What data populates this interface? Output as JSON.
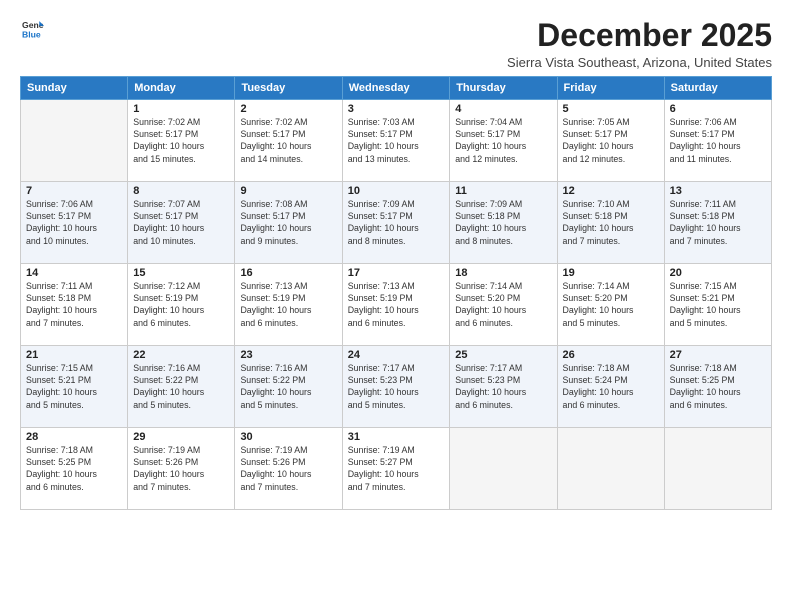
{
  "logo": {
    "line1": "General",
    "line2": "Blue"
  },
  "title": "December 2025",
  "location": "Sierra Vista Southeast, Arizona, United States",
  "headers": [
    "Sunday",
    "Monday",
    "Tuesday",
    "Wednesday",
    "Thursday",
    "Friday",
    "Saturday"
  ],
  "weeks": [
    [
      {
        "day": "",
        "info": ""
      },
      {
        "day": "1",
        "info": "Sunrise: 7:02 AM\nSunset: 5:17 PM\nDaylight: 10 hours\nand 15 minutes."
      },
      {
        "day": "2",
        "info": "Sunrise: 7:02 AM\nSunset: 5:17 PM\nDaylight: 10 hours\nand 14 minutes."
      },
      {
        "day": "3",
        "info": "Sunrise: 7:03 AM\nSunset: 5:17 PM\nDaylight: 10 hours\nand 13 minutes."
      },
      {
        "day": "4",
        "info": "Sunrise: 7:04 AM\nSunset: 5:17 PM\nDaylight: 10 hours\nand 12 minutes."
      },
      {
        "day": "5",
        "info": "Sunrise: 7:05 AM\nSunset: 5:17 PM\nDaylight: 10 hours\nand 12 minutes."
      },
      {
        "day": "6",
        "info": "Sunrise: 7:06 AM\nSunset: 5:17 PM\nDaylight: 10 hours\nand 11 minutes."
      }
    ],
    [
      {
        "day": "7",
        "info": "Sunrise: 7:06 AM\nSunset: 5:17 PM\nDaylight: 10 hours\nand 10 minutes."
      },
      {
        "day": "8",
        "info": "Sunrise: 7:07 AM\nSunset: 5:17 PM\nDaylight: 10 hours\nand 10 minutes."
      },
      {
        "day": "9",
        "info": "Sunrise: 7:08 AM\nSunset: 5:17 PM\nDaylight: 10 hours\nand 9 minutes."
      },
      {
        "day": "10",
        "info": "Sunrise: 7:09 AM\nSunset: 5:17 PM\nDaylight: 10 hours\nand 8 minutes."
      },
      {
        "day": "11",
        "info": "Sunrise: 7:09 AM\nSunset: 5:18 PM\nDaylight: 10 hours\nand 8 minutes."
      },
      {
        "day": "12",
        "info": "Sunrise: 7:10 AM\nSunset: 5:18 PM\nDaylight: 10 hours\nand 7 minutes."
      },
      {
        "day": "13",
        "info": "Sunrise: 7:11 AM\nSunset: 5:18 PM\nDaylight: 10 hours\nand 7 minutes."
      }
    ],
    [
      {
        "day": "14",
        "info": "Sunrise: 7:11 AM\nSunset: 5:18 PM\nDaylight: 10 hours\nand 7 minutes."
      },
      {
        "day": "15",
        "info": "Sunrise: 7:12 AM\nSunset: 5:19 PM\nDaylight: 10 hours\nand 6 minutes."
      },
      {
        "day": "16",
        "info": "Sunrise: 7:13 AM\nSunset: 5:19 PM\nDaylight: 10 hours\nand 6 minutes."
      },
      {
        "day": "17",
        "info": "Sunrise: 7:13 AM\nSunset: 5:19 PM\nDaylight: 10 hours\nand 6 minutes."
      },
      {
        "day": "18",
        "info": "Sunrise: 7:14 AM\nSunset: 5:20 PM\nDaylight: 10 hours\nand 6 minutes."
      },
      {
        "day": "19",
        "info": "Sunrise: 7:14 AM\nSunset: 5:20 PM\nDaylight: 10 hours\nand 5 minutes."
      },
      {
        "day": "20",
        "info": "Sunrise: 7:15 AM\nSunset: 5:21 PM\nDaylight: 10 hours\nand 5 minutes."
      }
    ],
    [
      {
        "day": "21",
        "info": "Sunrise: 7:15 AM\nSunset: 5:21 PM\nDaylight: 10 hours\nand 5 minutes."
      },
      {
        "day": "22",
        "info": "Sunrise: 7:16 AM\nSunset: 5:22 PM\nDaylight: 10 hours\nand 5 minutes."
      },
      {
        "day": "23",
        "info": "Sunrise: 7:16 AM\nSunset: 5:22 PM\nDaylight: 10 hours\nand 5 minutes."
      },
      {
        "day": "24",
        "info": "Sunrise: 7:17 AM\nSunset: 5:23 PM\nDaylight: 10 hours\nand 5 minutes."
      },
      {
        "day": "25",
        "info": "Sunrise: 7:17 AM\nSunset: 5:23 PM\nDaylight: 10 hours\nand 6 minutes."
      },
      {
        "day": "26",
        "info": "Sunrise: 7:18 AM\nSunset: 5:24 PM\nDaylight: 10 hours\nand 6 minutes."
      },
      {
        "day": "27",
        "info": "Sunrise: 7:18 AM\nSunset: 5:25 PM\nDaylight: 10 hours\nand 6 minutes."
      }
    ],
    [
      {
        "day": "28",
        "info": "Sunrise: 7:18 AM\nSunset: 5:25 PM\nDaylight: 10 hours\nand 6 minutes."
      },
      {
        "day": "29",
        "info": "Sunrise: 7:19 AM\nSunset: 5:26 PM\nDaylight: 10 hours\nand 7 minutes."
      },
      {
        "day": "30",
        "info": "Sunrise: 7:19 AM\nSunset: 5:26 PM\nDaylight: 10 hours\nand 7 minutes."
      },
      {
        "day": "31",
        "info": "Sunrise: 7:19 AM\nSunset: 5:27 PM\nDaylight: 10 hours\nand 7 minutes."
      },
      {
        "day": "",
        "info": ""
      },
      {
        "day": "",
        "info": ""
      },
      {
        "day": "",
        "info": ""
      }
    ]
  ]
}
